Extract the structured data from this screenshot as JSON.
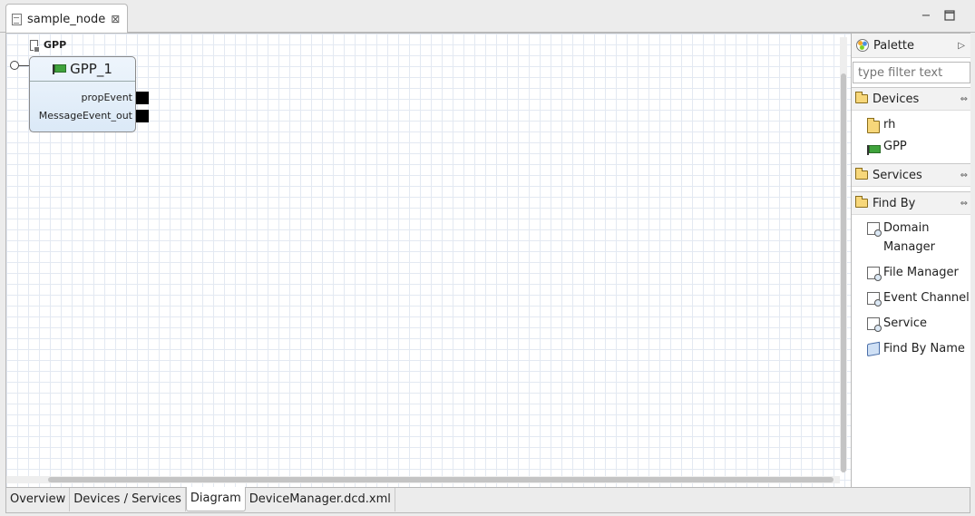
{
  "editor_tab": {
    "title": "sample_node"
  },
  "window": {
    "minimize": "−",
    "maximize": "□"
  },
  "diagram": {
    "device_label": "GPP",
    "node": {
      "name": "GPP_1",
      "ports": [
        "propEvent",
        "MessageEvent_out"
      ]
    }
  },
  "palette": {
    "title": "Palette",
    "filter_placeholder": "type filter text",
    "drawers": {
      "devices": {
        "label": "Devices",
        "items": [
          {
            "label": "rh",
            "icon": "folder-icon"
          },
          {
            "label": "GPP",
            "icon": "flag-icon"
          }
        ]
      },
      "services": {
        "label": "Services"
      },
      "find_by": {
        "label": "Find By",
        "items": [
          {
            "label": "Domain Manager",
            "icon": "find-by-icon"
          },
          {
            "label": "File Manager",
            "icon": "find-by-icon"
          },
          {
            "label": "Event Channel",
            "icon": "find-by-icon"
          },
          {
            "label": "Service",
            "icon": "find-by-icon"
          },
          {
            "label": "Find By Name",
            "icon": "book-icon"
          }
        ]
      }
    }
  },
  "bottom_tabs": [
    {
      "label": "Overview",
      "active": false
    },
    {
      "label": "Devices / Services",
      "active": false
    },
    {
      "label": "Diagram",
      "active": true
    },
    {
      "label": "DeviceManager.dcd.xml",
      "active": false
    }
  ]
}
